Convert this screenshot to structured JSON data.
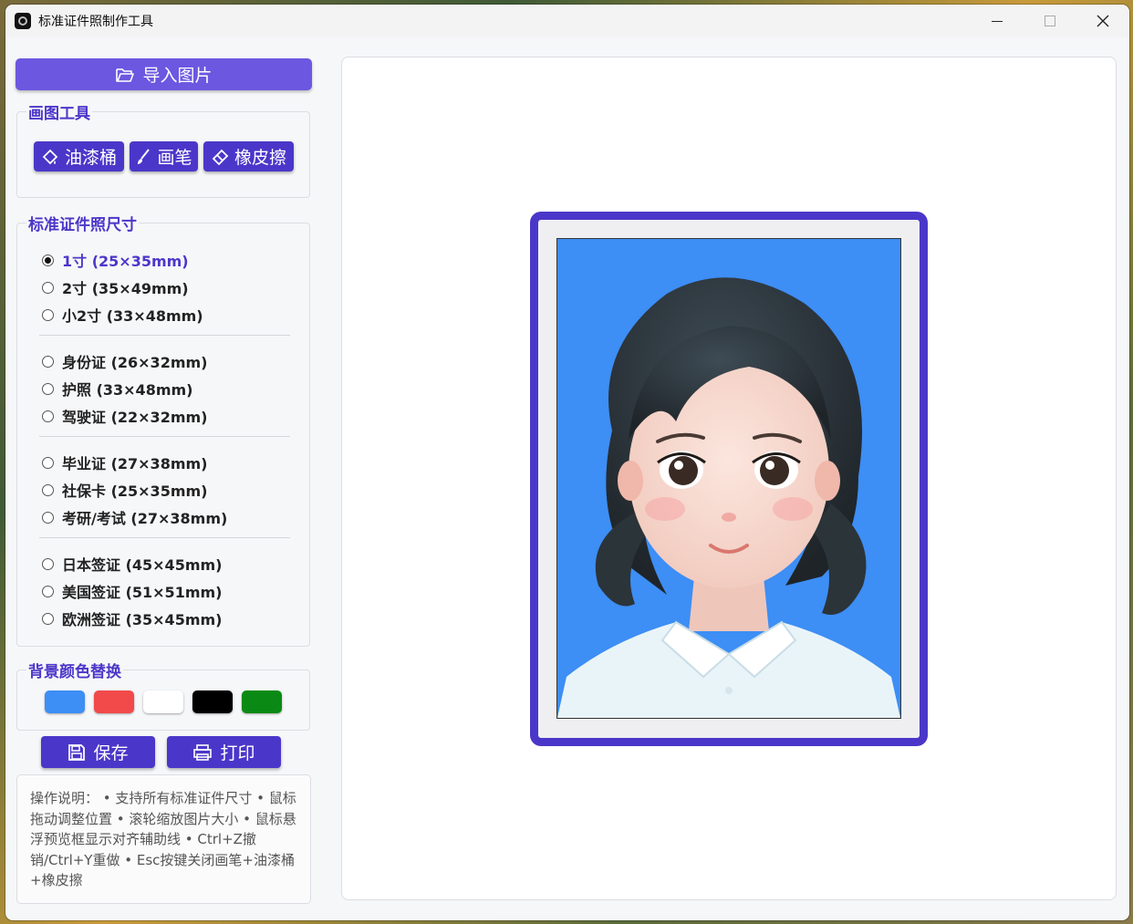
{
  "window": {
    "title": "标准证件照制作工具",
    "controls": {
      "minimize": "—",
      "maximize": "□",
      "close": "✕"
    }
  },
  "import_button": {
    "label": "导入图片",
    "icon": "folder-open-icon"
  },
  "drawing_tools": {
    "title": "画图工具",
    "buttons": [
      {
        "label": "油漆桶",
        "icon": "paint-bucket-icon"
      },
      {
        "label": "画笔",
        "icon": "brush-icon"
      },
      {
        "label": "橡皮擦",
        "icon": "eraser-icon"
      }
    ]
  },
  "sizes": {
    "title": "标准证件照尺寸",
    "groups": [
      [
        {
          "label": "1寸 (25×35mm)",
          "checked": true
        },
        {
          "label": "2寸 (35×49mm)",
          "checked": false
        },
        {
          "label": "小2寸 (33×48mm)",
          "checked": false
        }
      ],
      [
        {
          "label": "身份证 (26×32mm)",
          "checked": false
        },
        {
          "label": "护照 (33×48mm)",
          "checked": false
        },
        {
          "label": "驾驶证 (22×32mm)",
          "checked": false
        }
      ],
      [
        {
          "label": "毕业证 (27×38mm)",
          "checked": false
        },
        {
          "label": "社保卡 (25×35mm)",
          "checked": false
        },
        {
          "label": "考研/考试 (27×38mm)",
          "checked": false
        }
      ],
      [
        {
          "label": "日本签证 (45×45mm)",
          "checked": false
        },
        {
          "label": "美国签证 (51×51mm)",
          "checked": false
        },
        {
          "label": "欧洲签证 (35×45mm)",
          "checked": false
        }
      ]
    ]
  },
  "background": {
    "title": "背景颜色替换",
    "colors": [
      "#3d8ef5",
      "#f24a4a",
      "#ffffff",
      "#000000",
      "#0a8a14"
    ]
  },
  "actions": {
    "save": {
      "label": "保存",
      "icon": "save-icon"
    },
    "print": {
      "label": "打印",
      "icon": "printer-icon"
    }
  },
  "help": {
    "text": "操作说明： • 支持所有标准证件尺寸 • 鼠标拖动调整位置 • 滚轮缩放图片大小 • 鼠标悬浮预览框显示对齐辅助线 • Ctrl+Z撤销/Ctrl+Y重做 • Esc按键关闭画笔+油漆桶+橡皮擦"
  },
  "preview": {
    "background_color": "#3d8ef5",
    "frame_color": "#4a37c9"
  }
}
